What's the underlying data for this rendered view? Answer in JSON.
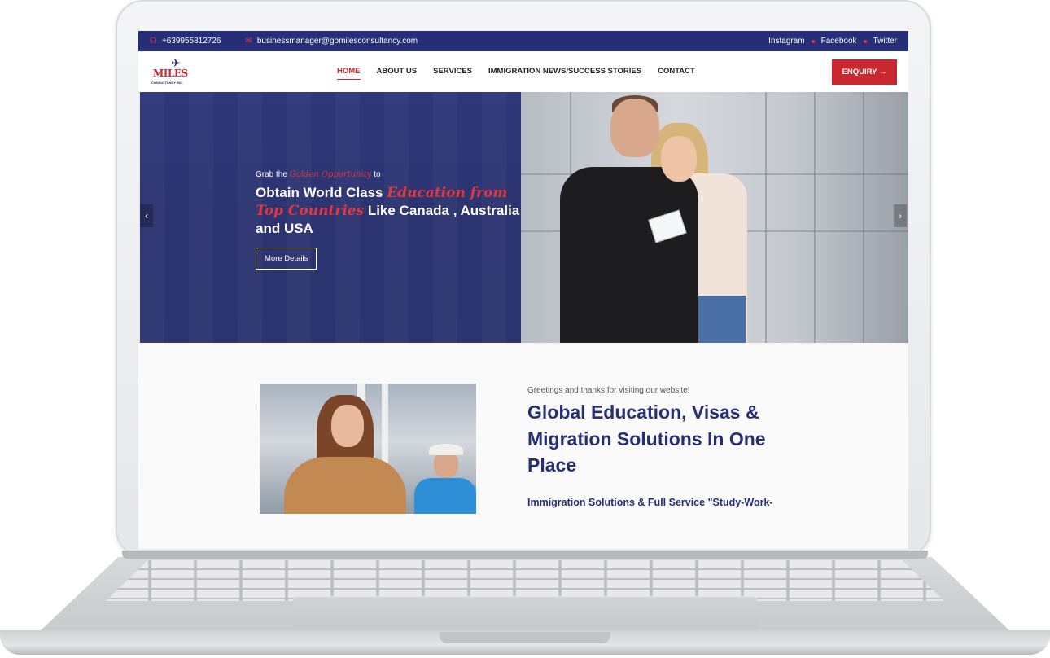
{
  "topbar": {
    "phone": "+639955812726",
    "email": "businessmanager@gomilesconsultancy.com",
    "social": [
      "Instagram",
      "Facebook",
      "Twitter"
    ]
  },
  "brand": {
    "logo_text": "MILES",
    "logo_sub": "CONSULTANCY INC."
  },
  "nav": {
    "items": [
      "HOME",
      "ABOUT US",
      "SERVICES",
      "IMMIGRATION NEWS/SUCCESS STORIES",
      "CONTACT"
    ],
    "active": "HOME",
    "enquiry": "ENQUIRY →"
  },
  "hero": {
    "grab_pre": "Grab the ",
    "grab_em": "Golden Opportunity",
    "grab_post": " to",
    "line1": "Obtain World Class ",
    "em1": "Education from Top Countries",
    "line2": " Like Canada , Australia and USA",
    "button": "More Details",
    "prev": "‹",
    "next": "›"
  },
  "welcome": {
    "greeting": "Greetings and thanks for visiting our website!",
    "title": "Global Education, Visas & Migration Solutions In One Place",
    "subtitle": "Immigration Solutions & Full Service \"Study-Work-"
  },
  "colors": {
    "navy": "#252e77",
    "red": "#c8282e",
    "accent_red": "#e0383e"
  },
  "icons": [
    "headset-icon",
    "mail-icon",
    "arrow-right-icon",
    "chevron-left-icon",
    "chevron-right-icon"
  ]
}
